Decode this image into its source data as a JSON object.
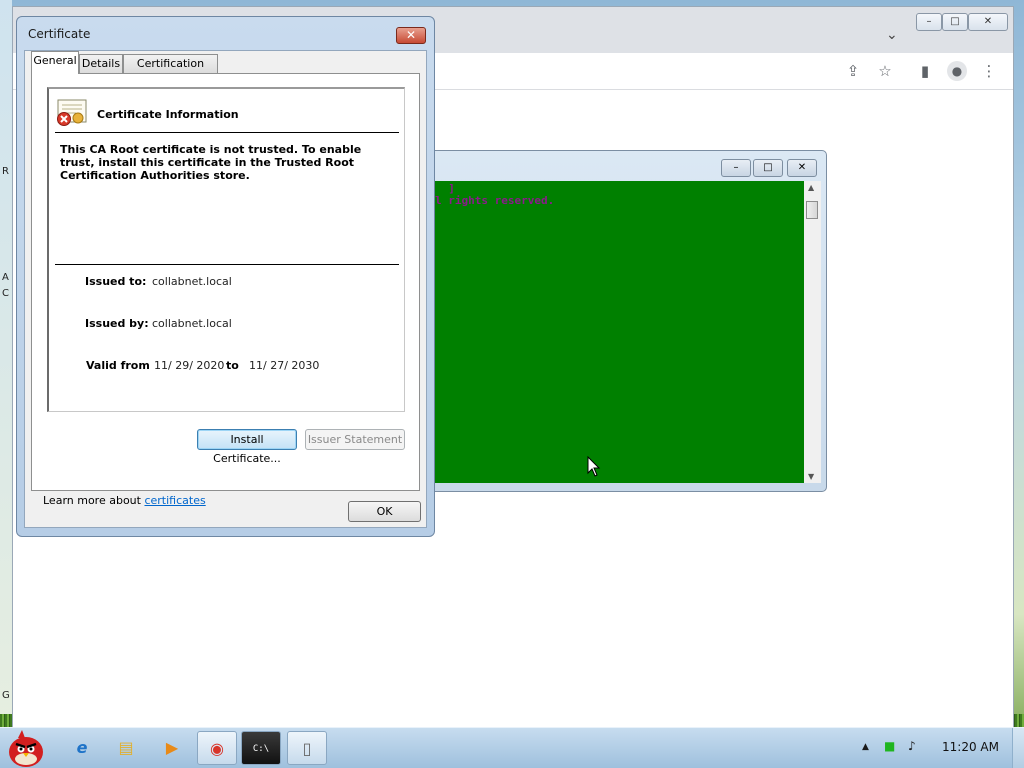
{
  "desktop": {
    "left_edge_glyphs": [
      "R",
      "A",
      "G",
      "C"
    ]
  },
  "browser": {
    "window_controls": [
      "–",
      "□",
      "✕"
    ],
    "tab_dropdown": "⌄",
    "toolbar_icons": {
      "share": "⇪",
      "star": "☆",
      "side_panel": "▮",
      "profile": "●",
      "menu": "⋮"
    }
  },
  "console": {
    "lines": [
      "  ]",
      "l rights reserved."
    ],
    "controls": [
      "–",
      "□",
      "✕"
    ]
  },
  "dialog": {
    "title": "Certificate",
    "close_label": "✕",
    "tabs": [
      {
        "label": "General"
      },
      {
        "label": "Details"
      },
      {
        "label": "Certification Path"
      }
    ],
    "heading": "Certificate Information",
    "notice": "This CA Root certificate is not trusted. To enable trust, install this certificate in the Trusted Root Certification Authorities store.",
    "issued_to_label": "Issued to:",
    "issued_to_value": "collabnet.local",
    "issued_by_label": "Issued by:",
    "issued_by_value": "collabnet.local",
    "valid_from_label": "Valid from",
    "valid_from_value": "11/ 29/ 2020",
    "to_label": "to",
    "valid_to_value": "11/ 27/ 2030",
    "install_button": "Install Certificate...",
    "issuer_button": "Issuer Statement",
    "learn_more_prefix": "Learn more about ",
    "learn_more_link": "certificates",
    "ok_button": "OK"
  },
  "taskbar": {
    "start_icon": "angry-bird-start",
    "pinned": [
      {
        "name": "internet-explorer-icon",
        "glyph": "e"
      },
      {
        "name": "folder-icon",
        "glyph": "▤"
      },
      {
        "name": "media-player-icon",
        "glyph": "▶"
      },
      {
        "name": "chrome-icon",
        "glyph": "◉"
      },
      {
        "name": "cmd-icon",
        "glyph": "C:\\"
      },
      {
        "name": "notepad-icon",
        "glyph": "▯"
      }
    ],
    "tray": {
      "show_hidden": "▲",
      "network": "■",
      "volume": "♪"
    },
    "clock": "11:20 AM"
  }
}
